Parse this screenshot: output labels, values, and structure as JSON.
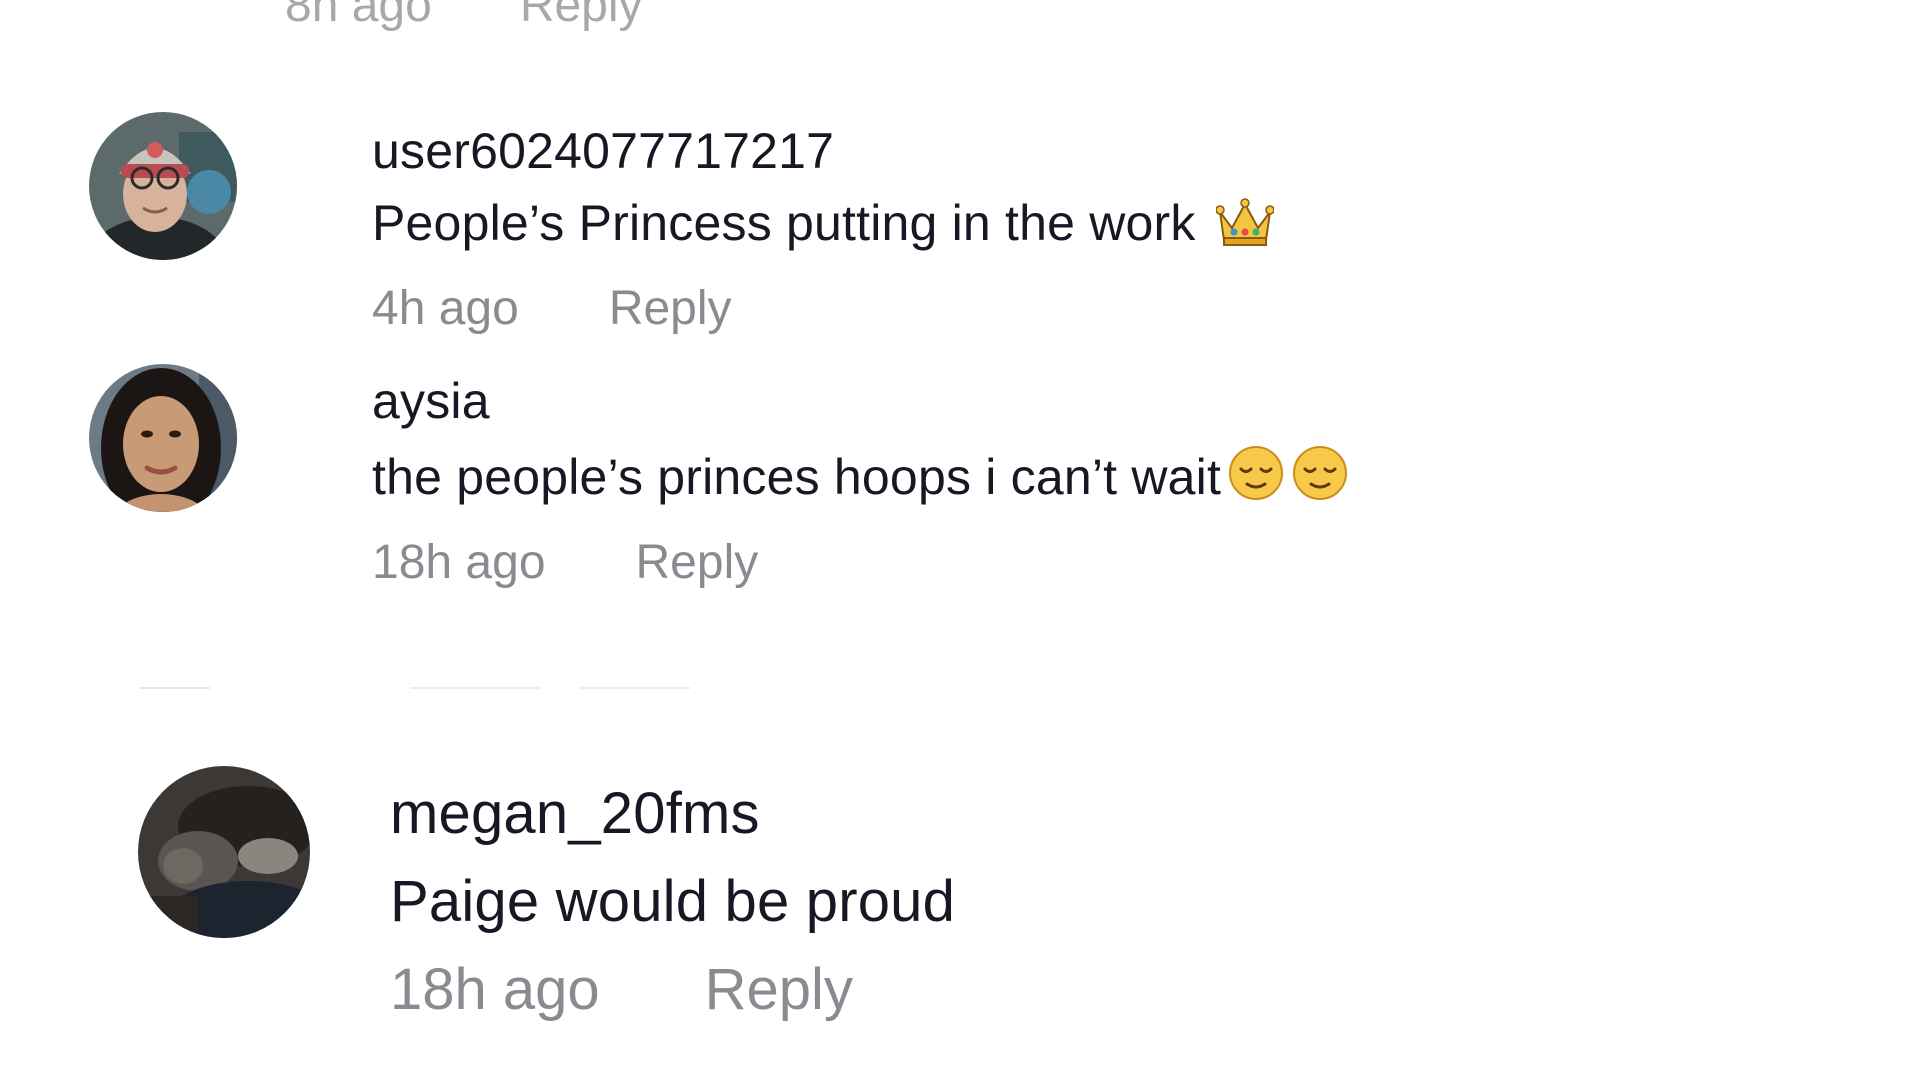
{
  "top_partial": {
    "time": "8h ago",
    "reply_label": "Reply"
  },
  "comments": [
    {
      "username": "user6024077717217",
      "text": "People’s Princess putting in the work",
      "emoji": [
        "crown-emoji"
      ],
      "time": "4h ago",
      "reply_label": "Reply"
    },
    {
      "username": "aysia",
      "text": "the people’s princes hoops i can’t wait",
      "emoji": [
        "relieved-face-emoji",
        "relieved-face-emoji"
      ],
      "time": "18h ago",
      "reply_label": "Reply"
    },
    {
      "username": "megan_20fms",
      "text": "Paige would be proud",
      "emoji": [],
      "time": "18h ago",
      "reply_label": "Reply"
    }
  ],
  "colors": {
    "text_primary": "#161823",
    "text_secondary": "#8a8b91",
    "background": "#ffffff"
  }
}
